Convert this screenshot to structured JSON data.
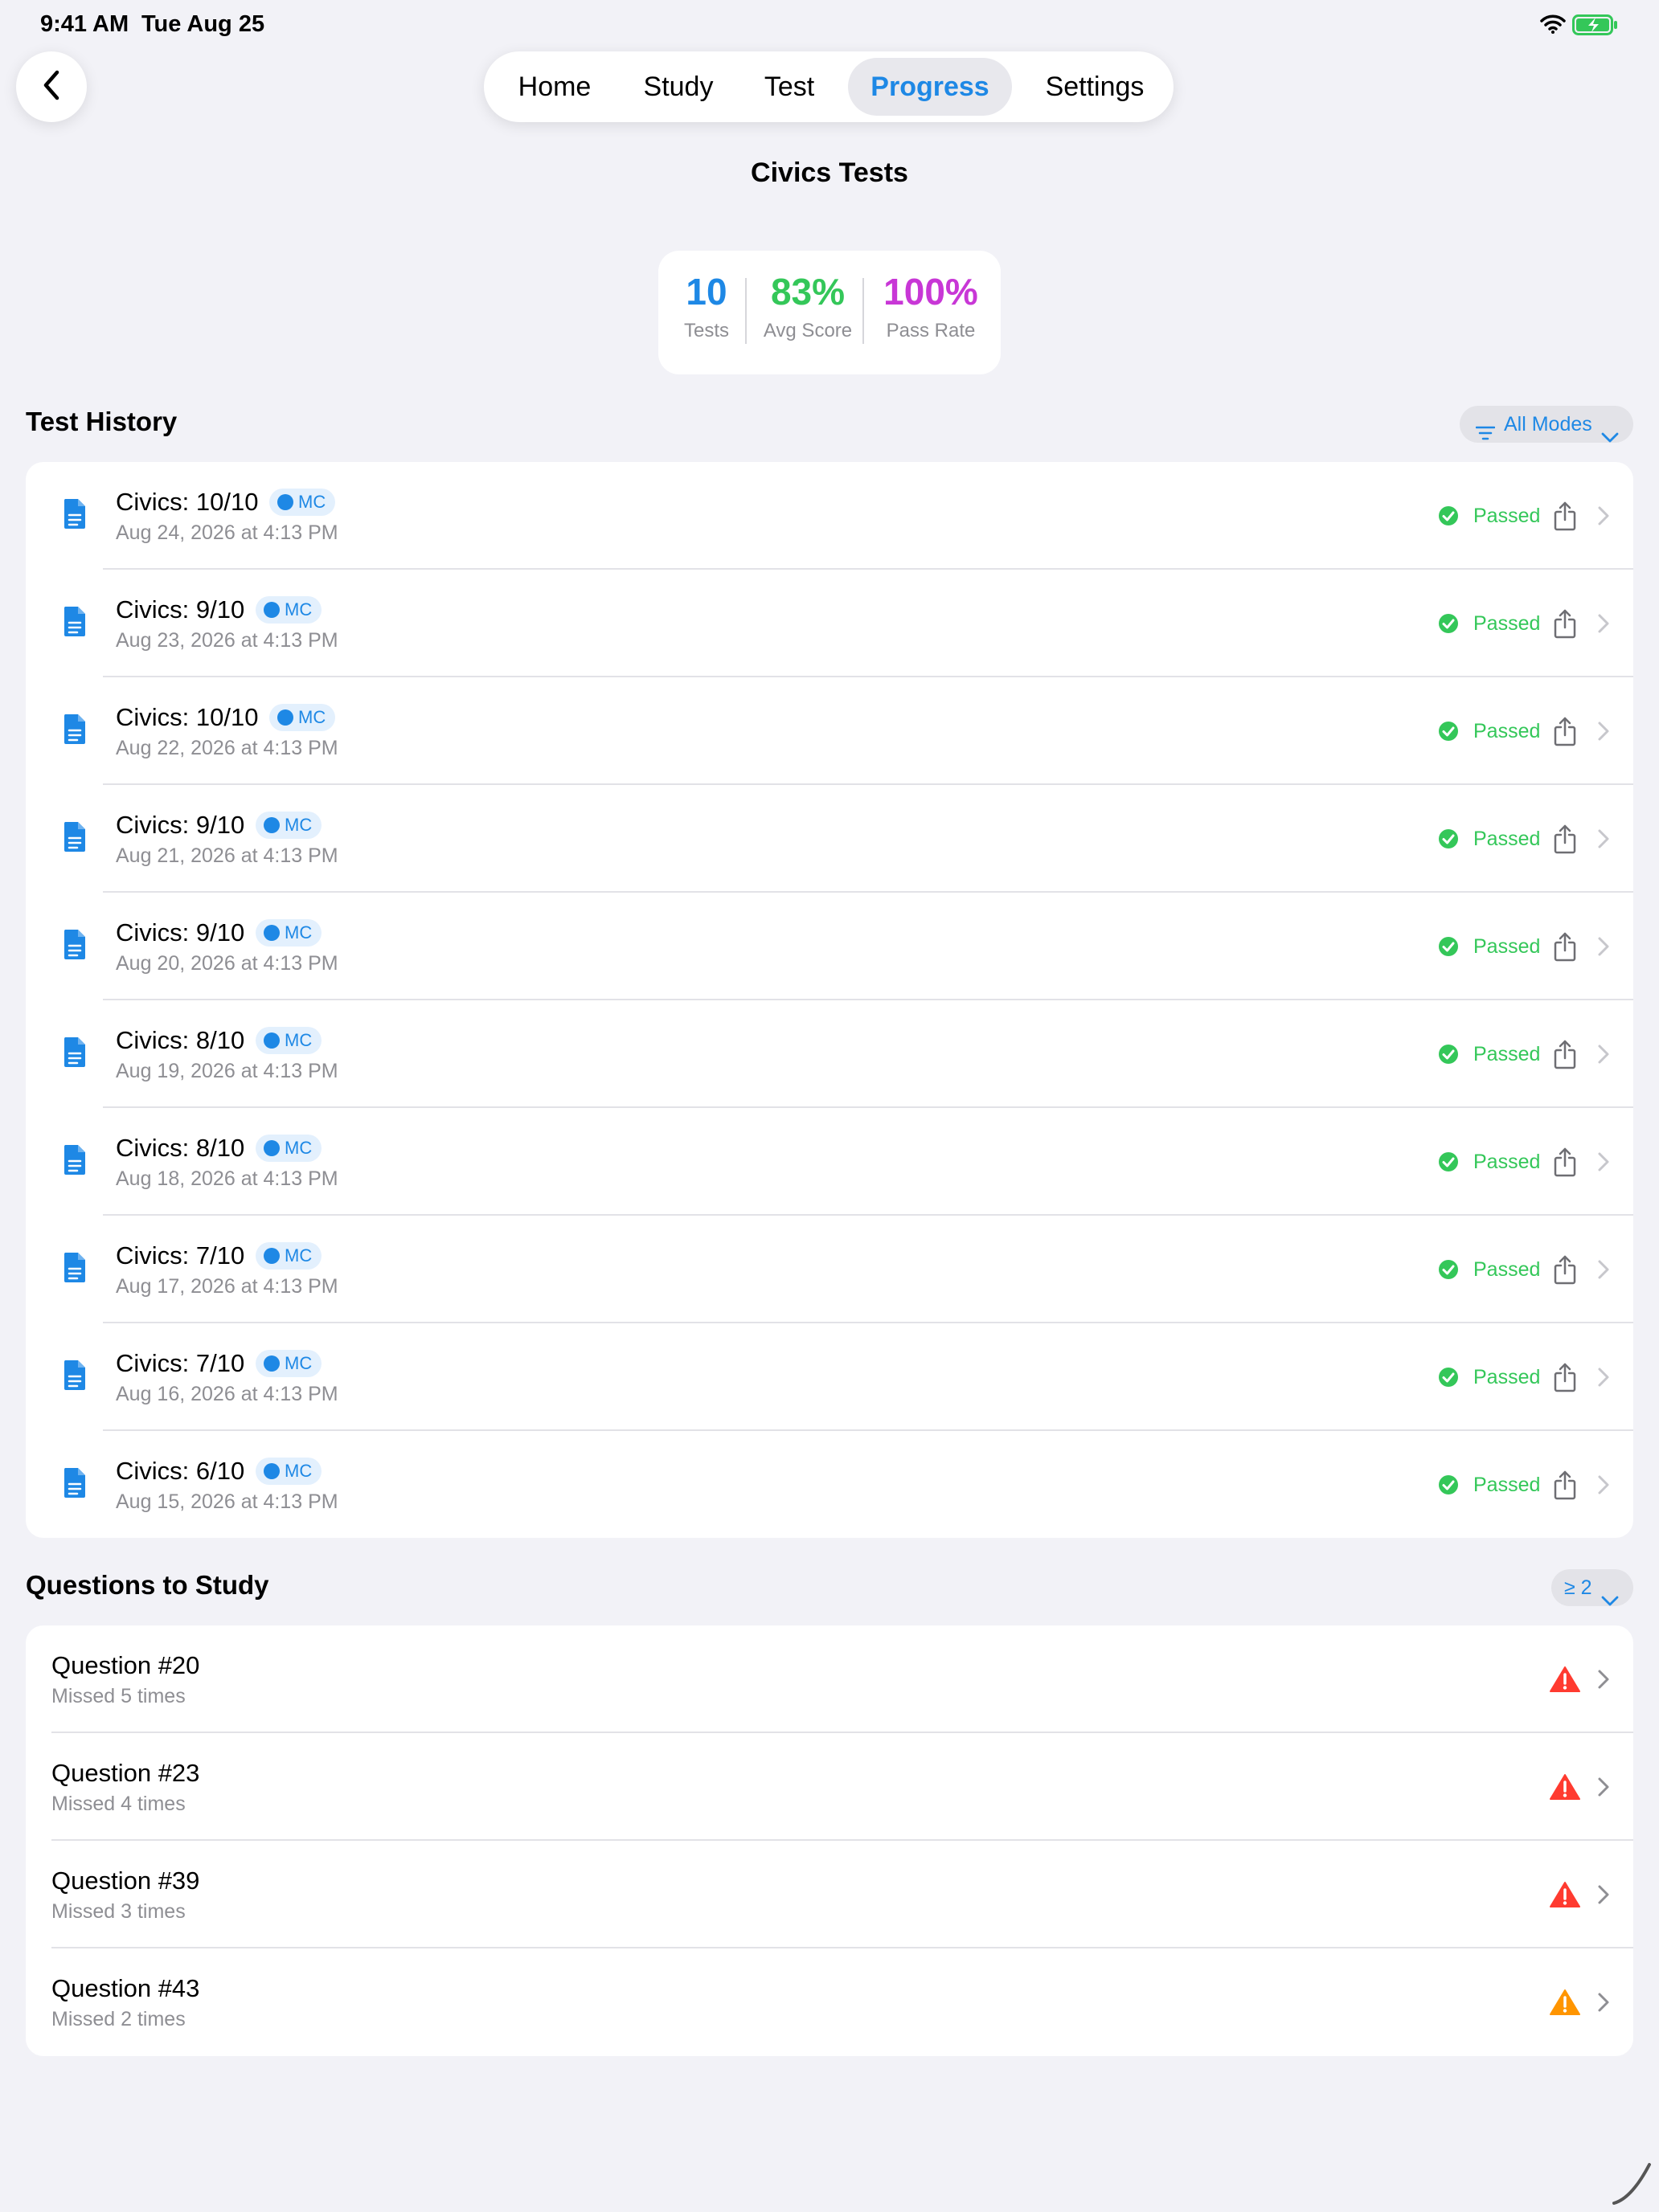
{
  "status_bar": {
    "time": "9:41 AM",
    "date": "Tue Aug 25"
  },
  "nav": {
    "tabs": [
      {
        "label": "Home"
      },
      {
        "label": "Study"
      },
      {
        "label": "Test"
      },
      {
        "label": "Progress",
        "active": true
      },
      {
        "label": "Settings"
      }
    ]
  },
  "page": {
    "title": "Civics Tests"
  },
  "stats": [
    {
      "value": "10",
      "label": "Tests",
      "color": "#1E88E5"
    },
    {
      "value": "83%",
      "label": "Avg Score",
      "color": "#34C759"
    },
    {
      "value": "100%",
      "label": "Pass Rate",
      "color": "#C837D6"
    }
  ],
  "test_history": {
    "title": "Test History",
    "filter_label": "All Modes",
    "rows": [
      {
        "title": "Civics: 10/10",
        "mode": "MC",
        "date": "Aug 24, 2026 at 4:13 PM",
        "status": "Passed"
      },
      {
        "title": "Civics: 9/10",
        "mode": "MC",
        "date": "Aug 23, 2026 at 4:13 PM",
        "status": "Passed"
      },
      {
        "title": "Civics: 10/10",
        "mode": "MC",
        "date": "Aug 22, 2026 at 4:13 PM",
        "status": "Passed"
      },
      {
        "title": "Civics: 9/10",
        "mode": "MC",
        "date": "Aug 21, 2026 at 4:13 PM",
        "status": "Passed"
      },
      {
        "title": "Civics: 9/10",
        "mode": "MC",
        "date": "Aug 20, 2026 at 4:13 PM",
        "status": "Passed"
      },
      {
        "title": "Civics: 8/10",
        "mode": "MC",
        "date": "Aug 19, 2026 at 4:13 PM",
        "status": "Passed"
      },
      {
        "title": "Civics: 8/10",
        "mode": "MC",
        "date": "Aug 18, 2026 at 4:13 PM",
        "status": "Passed"
      },
      {
        "title": "Civics: 7/10",
        "mode": "MC",
        "date": "Aug 17, 2026 at 4:13 PM",
        "status": "Passed"
      },
      {
        "title": "Civics: 7/10",
        "mode": "MC",
        "date": "Aug 16, 2026 at 4:13 PM",
        "status": "Passed"
      },
      {
        "title": "Civics: 6/10",
        "mode": "MC",
        "date": "Aug 15, 2026 at 4:13 PM",
        "status": "Passed"
      }
    ]
  },
  "questions_to_study": {
    "title": "Questions to Study",
    "filter_label": "≥ 2",
    "rows": [
      {
        "title": "Question #20",
        "subtitle": "Missed 5 times",
        "severity_color": "#FF3B30"
      },
      {
        "title": "Question #23",
        "subtitle": "Missed 4 times",
        "severity_color": "#FF3B30"
      },
      {
        "title": "Question #39",
        "subtitle": "Missed 3 times",
        "severity_color": "#FF3B30"
      },
      {
        "title": "Question #43",
        "subtitle": "Missed 2 times",
        "severity_color": "#FF9500"
      }
    ]
  },
  "colors": {
    "accent": "#1E88E5",
    "passed": "#34C759",
    "background": "#F2F2F7"
  }
}
